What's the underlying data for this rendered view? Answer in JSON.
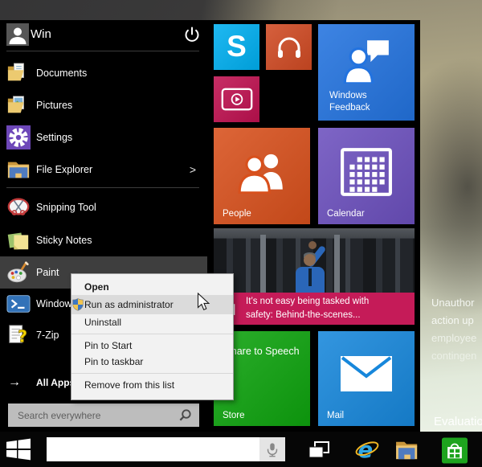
{
  "desktop": {
    "watermark_lines": [
      "Unauthor",
      "action up",
      "employee",
      "contingen"
    ],
    "evaluation_label": "Evaluatio"
  },
  "start_menu": {
    "user_name": "Win",
    "items": [
      {
        "label": "Documents",
        "icon": "documents-folder"
      },
      {
        "label": "Pictures",
        "icon": "pictures-folder"
      },
      {
        "label": "Settings",
        "icon": "settings-gear"
      },
      {
        "label": "File Explorer",
        "icon": "file-explorer-folder"
      },
      {
        "label": "Snipping Tool",
        "icon": "snipping-scissors"
      },
      {
        "label": "Sticky Notes",
        "icon": "sticky-notes"
      },
      {
        "label": "Paint",
        "icon": "paint-palette"
      },
      {
        "label": "Windows PowerShell",
        "icon": "powershell-prompt"
      },
      {
        "label": "7-Zip",
        "icon": "7zip-help-file"
      }
    ],
    "all_apps_label": "All Apps",
    "all_apps_arrow": "→",
    "submenu_chevron": ">",
    "search_placeholder": "Search everywhere"
  },
  "context_menu": {
    "open": "Open",
    "run_as_admin": "Run as administrator",
    "uninstall": "Uninstall",
    "pin_to_start": "Pin to Start",
    "pin_to_taskbar": "Pin to taskbar",
    "remove_from_list": "Remove from this list"
  },
  "tiles": {
    "skype": {
      "letter": "S",
      "color": "#00AFF0"
    },
    "music": {
      "color": "#D04A23"
    },
    "windows_feedback": {
      "label": "Windows Feedback",
      "color": "#2373DF"
    },
    "video": {
      "color": "#BF1150"
    },
    "people": {
      "label": "People",
      "color": "#D8501C"
    },
    "calendar": {
      "label": "Calendar",
      "color": "#6C50BE"
    },
    "news": {
      "headline": "It’s not easy being tasked with safety: Behind-the-scenes...",
      "banner_color": "#C51B58"
    },
    "store": {
      "label": "Store",
      "promo_text": "Share to Speech",
      "color": "#0EA30E"
    },
    "mail": {
      "label": "Mail",
      "color": "#1787DB"
    }
  }
}
